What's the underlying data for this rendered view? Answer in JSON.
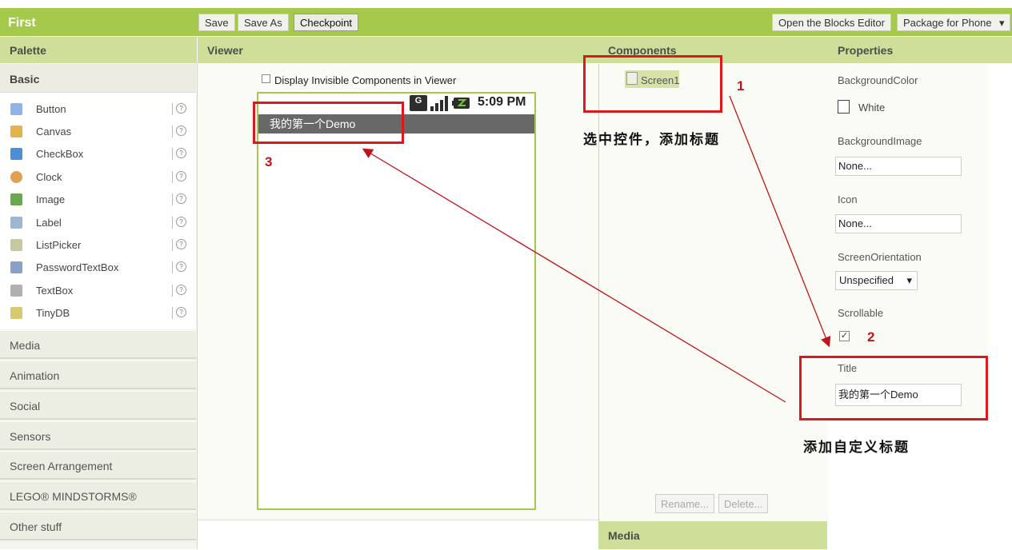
{
  "project": {
    "name": "First"
  },
  "toolbar": {
    "save": "Save",
    "save_as": "Save As",
    "checkpoint": "Checkpoint",
    "open_blocks": "Open the Blocks Editor",
    "package": "Package for Phone"
  },
  "headers": {
    "palette": "Palette",
    "viewer": "Viewer",
    "components": "Components",
    "properties": "Properties",
    "media": "Media"
  },
  "palette": {
    "basic": "Basic",
    "help_glyph": "?",
    "items": [
      {
        "label": "Button",
        "color": "#8fb5e8"
      },
      {
        "label": "Canvas",
        "color": "#e6b34a"
      },
      {
        "label": "CheckBox",
        "color": "#4a90d9"
      },
      {
        "label": "Clock",
        "color": "#e0a050"
      },
      {
        "label": "Image",
        "color": "#6aa84f"
      },
      {
        "label": "Label",
        "color": "#9bb7d4"
      },
      {
        "label": "ListPicker",
        "color": "#c8c8a0"
      },
      {
        "label": "PasswordTextBox",
        "color": "#8aa0c8"
      },
      {
        "label": "TextBox",
        "color": "#b0b0b0"
      },
      {
        "label": "TinyDB",
        "color": "#d8c870"
      }
    ],
    "categories": [
      "Media",
      "Animation",
      "Social",
      "Sensors",
      "Screen Arrangement",
      "LEGO® MINDSTORMS®",
      "Other stuff"
    ]
  },
  "viewer": {
    "display_invisible": "Display Invisible Components in Viewer",
    "time": "5:09 PM",
    "app_title": "我的第一个Demo"
  },
  "components": {
    "screen": "Screen1",
    "rename": "Rename...",
    "delete": "Delete..."
  },
  "properties": {
    "bg_color_label": "BackgroundColor",
    "bg_color_value": "White",
    "bg_image_label": "BackgroundImage",
    "bg_image_value": "None...",
    "icon_label": "Icon",
    "icon_value": "None...",
    "orientation_label": "ScreenOrientation",
    "orientation_value": "Unspecified",
    "scrollable_label": "Scrollable",
    "title_label": "Title",
    "title_value": "我的第一个Demo"
  },
  "annotations": {
    "n1": "1",
    "n2": "2",
    "n3": "3",
    "note1": "选中控件，添加标题",
    "note2": "添加自定义标题"
  }
}
